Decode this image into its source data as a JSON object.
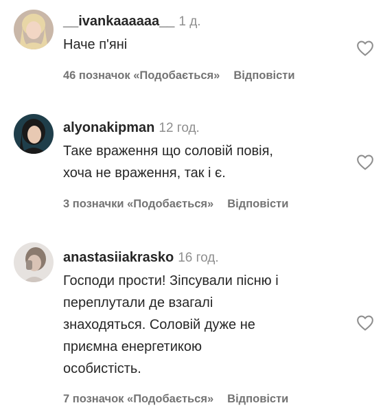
{
  "comments": [
    {
      "username": "__ivankaaaaaa__",
      "time": "1 д.",
      "lines": [
        "Наче п'яні"
      ],
      "likes": "46 позначок «Подобається»",
      "reply": "Відповісти",
      "avatar_colors": {
        "bg": "#c9b7a8",
        "hair": "#e8d6a6",
        "face": "#f2d6c4"
      }
    },
    {
      "username": "alyonakipman",
      "time": "12 год.",
      "lines": [
        "Таке враження що соловій повія,",
        "хоча не враження, так і є."
      ],
      "likes": "3 позначки «Подобається»",
      "reply": "Відповісти",
      "avatar_colors": {
        "bg": "#1f3e4a",
        "hair": "#1a1a1a",
        "face": "#e8c9b3"
      }
    },
    {
      "username": "anastasiiakrasko",
      "time": "16 год.",
      "lines": [
        "Господи прости! Зіпсували пісню і",
        "переплутали де взагалі",
        "знаходяться. Соловій дуже не",
        "приємна енергетикою",
        "особистість."
      ],
      "likes": "7 позначок «Подобається»",
      "reply": "Відповісти",
      "avatar_colors": {
        "bg": "#e6e2df",
        "hair": "#8a7a6e",
        "face": "#d9c3b5"
      }
    }
  ],
  "icons": {
    "like": "heart-outline-icon"
  },
  "colors": {
    "text": "#262626",
    "secondary": "#8e8e8e",
    "meta": "#737373"
  }
}
